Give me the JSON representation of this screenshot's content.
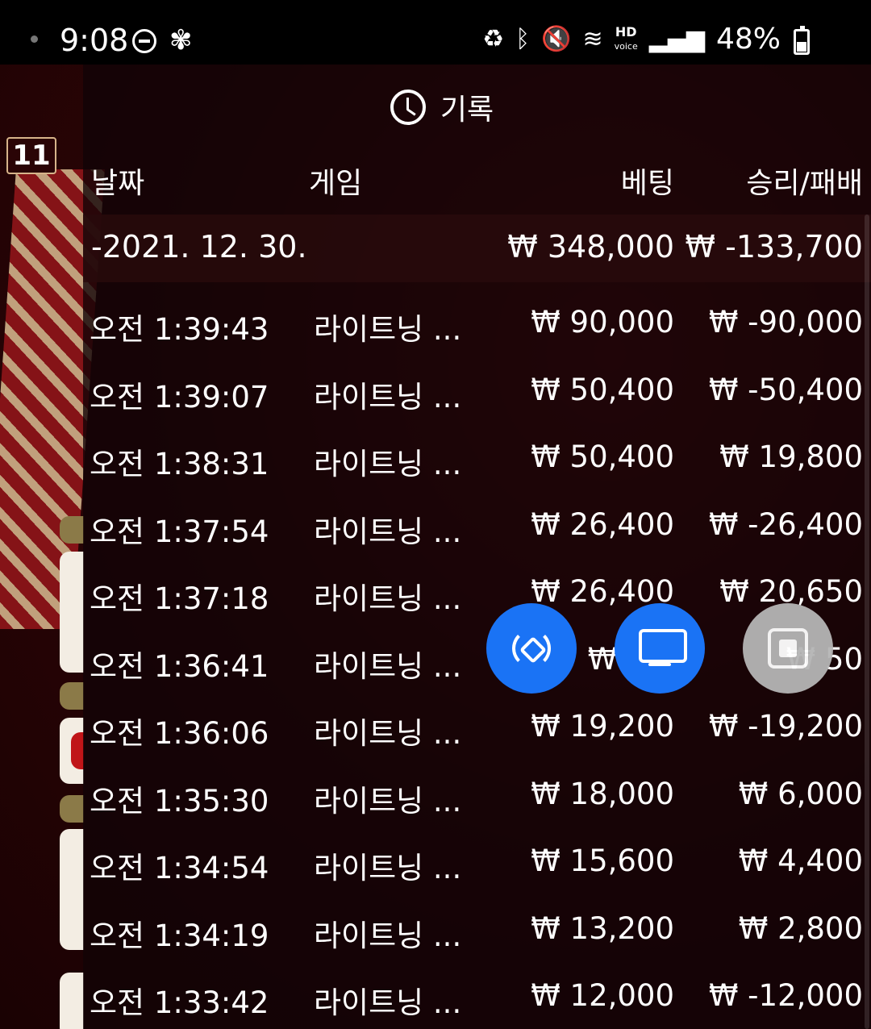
{
  "status_bar": {
    "time": "9:08",
    "wifi_label": "HD",
    "voice_label": "voice",
    "battery": "48%"
  },
  "game_bg": {
    "badge": "11"
  },
  "history": {
    "title": "기록",
    "headers": {
      "date": "날짜",
      "game": "게임",
      "bet": "베팅",
      "result": "승리/패배"
    },
    "date_group": {
      "label": "-2021. 12. 30.",
      "bet": "₩ 348,000",
      "result": "₩ -133,700"
    },
    "rows": [
      {
        "time": "오전 1:39:43",
        "game": "라이트닝 ...",
        "bet": "₩ 90,000",
        "result": "₩ -90,000"
      },
      {
        "time": "오전 1:39:07",
        "game": "라이트닝 ...",
        "bet": "₩ 50,400",
        "result": "₩ -50,400"
      },
      {
        "time": "오전 1:38:31",
        "game": "라이트닝 ...",
        "bet": "₩ 50,400",
        "result": "₩ 19,800"
      },
      {
        "time": "오전 1:37:54",
        "game": "라이트닝 ...",
        "bet": "₩ 26,400",
        "result": "₩ -26,400"
      },
      {
        "time": "오전 1:37:18",
        "game": "라이트닝 ...",
        "bet": "₩ 26,400",
        "result": "₩ 20,650"
      },
      {
        "time": "오전 1:36:41",
        "game": "라이트닝 ...",
        "bet": "₩ 26,",
        "result": "₩ 50"
      },
      {
        "time": "오전 1:36:06",
        "game": "라이트닝 ...",
        "bet": "₩ 19,200",
        "result": "₩ -19,200"
      },
      {
        "time": "오전 1:35:30",
        "game": "라이트닝 ...",
        "bet": "₩ 18,000",
        "result": "₩ 6,000"
      },
      {
        "time": "오전 1:34:54",
        "game": "라이트닝 ...",
        "bet": "₩ 15,600",
        "result": "₩ 4,400"
      },
      {
        "time": "오전 1:34:19",
        "game": "라이트닝 ...",
        "bet": "₩ 13,200",
        "result": "₩ 2,800"
      },
      {
        "time": "오전 1:33:42",
        "game": "라이트닝 ...",
        "bet": "₩ 12,000",
        "result": "₩ -12,000"
      }
    ]
  },
  "floating_buttons": {
    "rotate": {
      "icon": "rotate-icon",
      "color": "#1a73f5"
    },
    "screen": {
      "icon": "monitor-icon",
      "color": "#1a73f5"
    },
    "stop": {
      "icon": "stop-icon",
      "color": "#b5b5b5"
    }
  }
}
